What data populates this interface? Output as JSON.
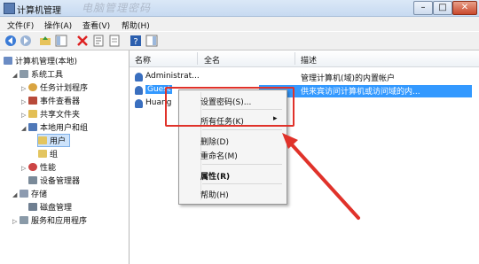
{
  "window": {
    "title": "计算机管理",
    "watermark": "电脑管理密码",
    "min": "–",
    "max": "□",
    "close": "✕"
  },
  "menubar": [
    "文件(F)",
    "操作(A)",
    "查看(V)",
    "帮助(H)"
  ],
  "tree": {
    "root": "计算机管理(本地)",
    "system_tools": "系统工具",
    "task_scheduler": "任务计划程序",
    "event_viewer": "事件查看器",
    "shared_folders": "共享文件夹",
    "local_users_groups": "本地用户和组",
    "users": "用户",
    "groups": "组",
    "performance": "性能",
    "device_manager": "设备管理器",
    "storage": "存储",
    "disk_management": "磁盘管理",
    "services_apps": "服务和应用程序"
  },
  "list": {
    "columns": [
      "名称",
      "全名",
      "描述"
    ],
    "rows": [
      {
        "name": "Administrat...",
        "full": "",
        "desc": "管理计算机(域)的内置帐户"
      },
      {
        "name": "Guest",
        "full": "",
        "desc": "供来宾访问计算机或访问域的内..."
      },
      {
        "name": "Huang",
        "full": "",
        "desc": ""
      }
    ]
  },
  "context_menu": {
    "set_password": "设置密码(S)...",
    "all_tasks": "所有任务(K)",
    "delete": "删除(D)",
    "rename": "重命名(M)",
    "properties": "属性(R)",
    "help": "帮助(H)",
    "submenu_arrow": "▸"
  },
  "colors": {
    "annotation_red": "#e0322a",
    "selection_blue": "#3399ff"
  }
}
